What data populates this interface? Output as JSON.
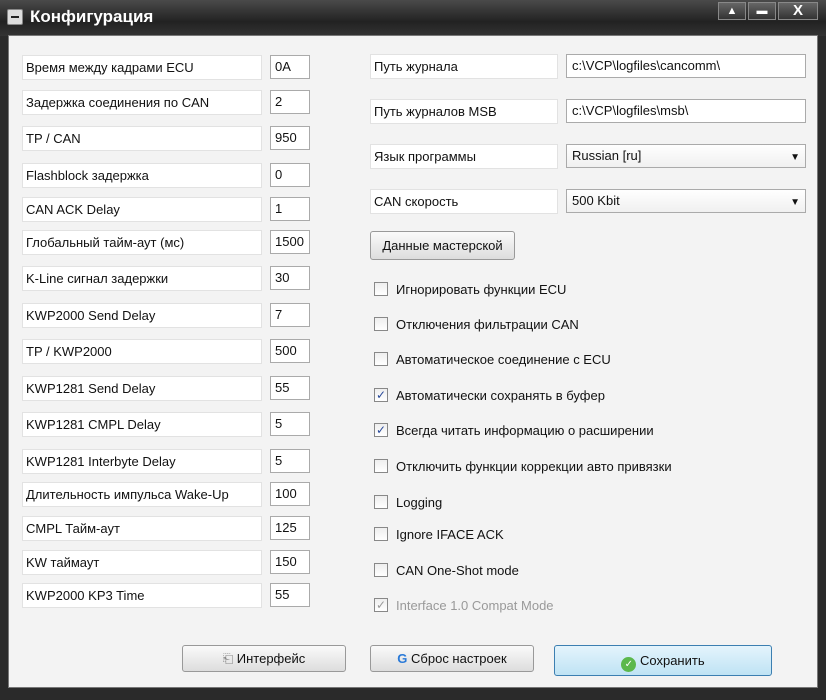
{
  "window": {
    "title": "Конфигурация",
    "buttons": [
      "▲",
      "▬",
      "X"
    ]
  },
  "params": [
    {
      "label": "Время между кадрами ECU",
      "value": "0A"
    },
    {
      "label": "Задержка соединения по CAN",
      "value": "2"
    },
    {
      "label": "TP / CAN",
      "value": "950"
    },
    {
      "label": "Flashblock задержка",
      "value": "0"
    },
    {
      "label": "CAN ACK Delay",
      "value": "1"
    },
    {
      "label": "Глобальный тайм-аут (мс)",
      "value": "1500"
    },
    {
      "label": "K-Line сигнал задержки",
      "value": "30"
    },
    {
      "label": "KWP2000 Send Delay",
      "value": "7"
    },
    {
      "label": "TP / KWP2000",
      "value": "500"
    },
    {
      "label": "KWP1281 Send Delay",
      "value": "55"
    },
    {
      "label": "KWP1281 CMPL Delay",
      "value": "5"
    },
    {
      "label": "KWP1281 Interbyte Delay",
      "value": "5"
    },
    {
      "label": "Длительность импульса Wake-Up",
      "value": "100"
    },
    {
      "label": "CMPL Тайм-аут",
      "value": "125"
    },
    {
      "label": "KW таймаут",
      "value": "150"
    },
    {
      "label": "KWP2000 KP3 Time",
      "value": "55"
    }
  ],
  "settings": [
    {
      "label": "Путь журнала",
      "value": "c:\\VCP\\logfiles\\cancomm\\"
    },
    {
      "label": "Путь журналов MSB",
      "value": "c:\\VCP\\logfiles\\msb\\"
    },
    {
      "label": "Язык программы",
      "value": "Russian [ru]"
    },
    {
      "label": "CAN скорость",
      "value": "500 Kbit"
    }
  ],
  "workshop_button": "Данные мастерской",
  "checkboxes": [
    {
      "label": "Игнорировать функции ECU",
      "checked": false
    },
    {
      "label": "Отключения фильтрации CAN",
      "checked": false
    },
    {
      "label": "Автоматическое соединение с ECU",
      "checked": false
    },
    {
      "label": "Автоматически сохранять в буфер",
      "checked": true
    },
    {
      "label": "Всегда читать информацию о расширении",
      "checked": true
    },
    {
      "label": "Отключить функции коррекции авто привязки",
      "checked": false
    },
    {
      "label": "Logging",
      "checked": false
    },
    {
      "label": "Ignore IFACE ACK",
      "checked": false
    },
    {
      "label": "CAN One-Shot mode",
      "checked": false
    },
    {
      "label": "Interface 1.0 Compat Mode",
      "checked": true,
      "disabled": true
    }
  ],
  "footer": {
    "interface": "Интерфейс",
    "reset": "Сброс настроек",
    "save": "Сохранить"
  }
}
